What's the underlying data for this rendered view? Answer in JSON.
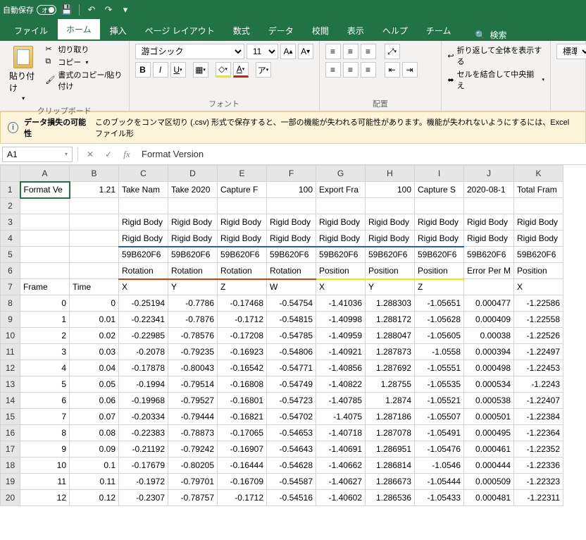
{
  "titlebar": {
    "auto_save": "自動保存",
    "toggle": "オフ"
  },
  "tabs": {
    "file": "ファイル",
    "home": "ホーム",
    "insert": "挿入",
    "layout": "ページ レイアウト",
    "formula": "数式",
    "data": "データ",
    "review": "校閲",
    "view": "表示",
    "help": "ヘルプ",
    "team": "チーム",
    "search": "検索"
  },
  "ribbon": {
    "clipboard": {
      "label": "クリップボード",
      "paste": "貼り付け",
      "cut": "切り取り",
      "copy": "コピー",
      "fmt": "書式のコピー/貼り付け"
    },
    "font": {
      "label": "フォント",
      "name": "游ゴシック",
      "size": "11"
    },
    "align": {
      "label": "配置",
      "wrap": "折り返して全体を表示する",
      "merge": "セルを結合して中央揃え"
    },
    "number": {
      "label": "",
      "style": "標準"
    }
  },
  "warning": {
    "title": "データ損失の可能性",
    "msg": "このブックをコンマ区切り (.csv) 形式で保存すると、一部の機能が失われる可能性があります。機能が失われないようにするには、Excel ファイル形"
  },
  "formula": {
    "cell": "A1",
    "value": "Format Version"
  },
  "cols": [
    "A",
    "B",
    "C",
    "D",
    "E",
    "F",
    "G",
    "H",
    "I",
    "J",
    "K"
  ],
  "row1": {
    "A": "Format Ve",
    "B": "1.21",
    "C": "Take Nam",
    "D": "Take 2020",
    "E": "Capture F",
    "F": "100",
    "G": "Export Fra",
    "H": "100",
    "I": "Capture S",
    "J": "2020-08-1",
    "K": "Total Fram"
  },
  "row3": {
    "v": "Rigid Body"
  },
  "row4": {
    "v": "Rigid Body"
  },
  "row5": {
    "v": "59B620F6"
  },
  "row6": {
    "rot": "Rotation",
    "pos": "Position",
    "err": "Error Per M"
  },
  "row7": {
    "A": "Frame",
    "B": "Time",
    "C": "X",
    "D": "Y",
    "E": "Z",
    "F": "W",
    "G": "X",
    "H": "Y",
    "I": "Z",
    "J": "",
    "K": "X"
  },
  "data": [
    {
      "f": "0",
      "t": "0",
      "c": "-0.25194",
      "d": "-0.7786",
      "e": "-0.17468",
      "g": "-0.54754",
      "h": "-1.41036",
      "i": "1.288303",
      "j": "-1.05651",
      "k": "0.000477",
      "l": "-1.22586"
    },
    {
      "f": "1",
      "t": "0.01",
      "c": "-0.22341",
      "d": "-0.7876",
      "e": "-0.1712",
      "g": "-0.54815",
      "h": "-1.40998",
      "i": "1.288172",
      "j": "-1.05628",
      "k": "0.000409",
      "l": "-1.22558"
    },
    {
      "f": "2",
      "t": "0.02",
      "c": "-0.22985",
      "d": "-0.78576",
      "e": "-0.17208",
      "g": "-0.54785",
      "h": "-1.40959",
      "i": "1.288047",
      "j": "-1.05605",
      "k": "0.00038",
      "l": "-1.22526"
    },
    {
      "f": "3",
      "t": "0.03",
      "c": "-0.2078",
      "d": "-0.79235",
      "e": "-0.16923",
      "g": "-0.54806",
      "h": "-1.40921",
      "i": "1.287873",
      "j": "-1.0558",
      "k": "0.000394",
      "l": "-1.22497"
    },
    {
      "f": "4",
      "t": "0.04",
      "c": "-0.17878",
      "d": "-0.80043",
      "e": "-0.16542",
      "g": "-0.54771",
      "h": "-1.40856",
      "i": "1.287692",
      "j": "-1.05551",
      "k": "0.000498",
      "l": "-1.22453"
    },
    {
      "f": "5",
      "t": "0.05",
      "c": "-0.1994",
      "d": "-0.79514",
      "e": "-0.16808",
      "g": "-0.54749",
      "h": "-1.40822",
      "i": "1.28755",
      "j": "-1.05535",
      "k": "0.000534",
      "l": "-1.2243"
    },
    {
      "f": "6",
      "t": "0.06",
      "c": "-0.19968",
      "d": "-0.79527",
      "e": "-0.16801",
      "g": "-0.54723",
      "h": "-1.40785",
      "i": "1.2874",
      "j": "-1.05521",
      "k": "0.000538",
      "l": "-1.22407"
    },
    {
      "f": "7",
      "t": "0.07",
      "c": "-0.20334",
      "d": "-0.79444",
      "e": "-0.16821",
      "g": "-0.54702",
      "h": "-1.4075",
      "i": "1.287186",
      "j": "-1.05507",
      "k": "0.000501",
      "l": "-1.22384"
    },
    {
      "f": "8",
      "t": "0.08",
      "c": "-0.22383",
      "d": "-0.78873",
      "e": "-0.17065",
      "g": "-0.54653",
      "h": "-1.40718",
      "i": "1.287078",
      "j": "-1.05491",
      "k": "0.000495",
      "l": "-1.22364"
    },
    {
      "f": "9",
      "t": "0.09",
      "c": "-0.21192",
      "d": "-0.79242",
      "e": "-0.16907",
      "g": "-0.54643",
      "h": "-1.40691",
      "i": "1.286951",
      "j": "-1.05476",
      "k": "0.000461",
      "l": "-1.22352"
    },
    {
      "f": "10",
      "t": "0.1",
      "c": "-0.17679",
      "d": "-0.80205",
      "e": "-0.16444",
      "g": "-0.54628",
      "h": "-1.40662",
      "i": "1.286814",
      "j": "-1.0546",
      "k": "0.000444",
      "l": "-1.22336"
    },
    {
      "f": "11",
      "t": "0.11",
      "c": "-0.1972",
      "d": "-0.79701",
      "e": "-0.16709",
      "g": "-0.54587",
      "h": "-1.40627",
      "i": "1.286673",
      "j": "-1.05444",
      "k": "0.000509",
      "l": "-1.22323"
    },
    {
      "f": "12",
      "t": "0.12",
      "c": "-0.2307",
      "d": "-0.78757",
      "e": "-0.1712",
      "g": "-0.54516",
      "h": "-1.40602",
      "i": "1.286536",
      "j": "-1.05433",
      "k": "0.000481",
      "l": "-1.22311"
    }
  ]
}
